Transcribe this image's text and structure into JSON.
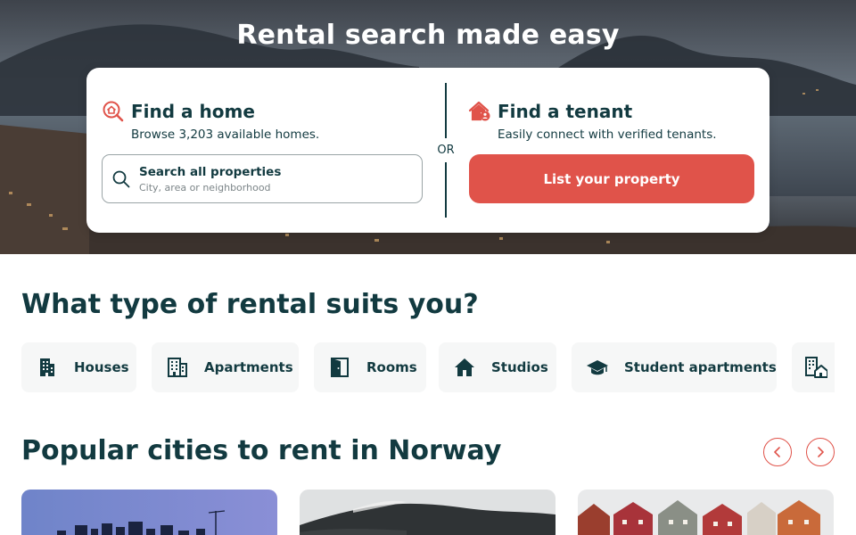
{
  "hero": {
    "title": "Rental search made easy"
  },
  "find_home": {
    "icon": "home-search-icon",
    "title": "Find a home",
    "subtitle": "Browse 3,203 available homes.",
    "search": {
      "icon": "search-icon",
      "label": "Search all properties",
      "placeholder": "City, area or neighborhood"
    }
  },
  "divider_label": "OR",
  "find_tenant": {
    "icon": "home-person-icon",
    "title": "Find a tenant",
    "subtitle": "Easily connect with verified tenants.",
    "button_label": "List your property"
  },
  "rental_types": {
    "title": "What type of rental suits you?",
    "items": [
      {
        "label": "Houses",
        "icon": "building-icon"
      },
      {
        "label": "Apartments",
        "icon": "apartment-building-icon"
      },
      {
        "label": "Rooms",
        "icon": "door-icon"
      },
      {
        "label": "Studios",
        "icon": "house-icon"
      },
      {
        "label": "Student apartments",
        "icon": "graduation-cap-icon"
      },
      {
        "label": "",
        "icon": "building-house-icon"
      }
    ]
  },
  "popular_cities": {
    "title": "Popular cities to rent in Norway",
    "prev_icon": "chevron-left-icon",
    "next_icon": "chevron-right-icon"
  },
  "colors": {
    "primary_dark": "#123a40",
    "accent": "#e0534a",
    "chip_bg": "#f6f7f7"
  }
}
